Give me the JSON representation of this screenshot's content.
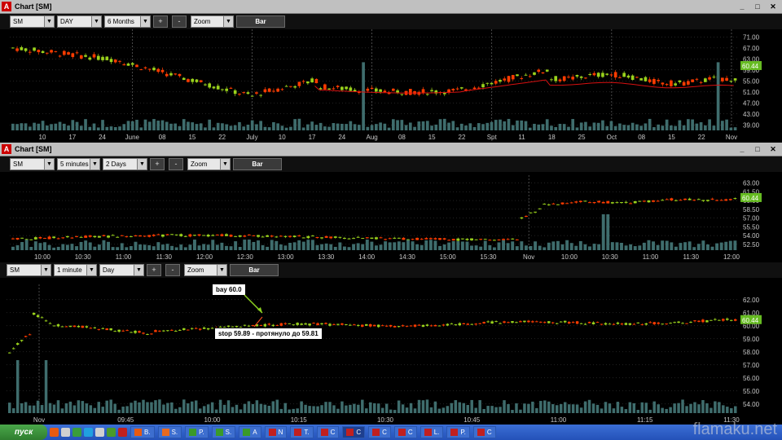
{
  "chart_data": [
    {
      "type": "candlestick",
      "symbol": "SM",
      "interval": "DAY",
      "range": "6 Months",
      "y_ticks": [
        "71.00",
        "67.00",
        "63.00",
        "59.00",
        "55.00",
        "51.00",
        "47.00",
        "43.00",
        "39.00"
      ],
      "x_labels": [
        "10",
        "17",
        "24",
        "June",
        "08",
        "15",
        "22",
        "July",
        "10",
        "17",
        "24",
        "Aug",
        "08",
        "15",
        "22",
        "Spt",
        "11",
        "18",
        "25",
        "Oct",
        "08",
        "15",
        "22",
        "Nov"
      ],
      "last_price": "60.44",
      "ylim": [
        37,
        72
      ],
      "ma": true
    },
    {
      "type": "candlestick",
      "symbol": "SM",
      "interval": "5 minutes",
      "range": "2 Days",
      "y_ticks": [
        "63.00",
        "61.50",
        "60.00",
        "58.50",
        "57.00",
        "55.50",
        "54.00",
        "52.50"
      ],
      "x_labels": [
        "10:00",
        "10:30",
        "11:00",
        "11:30",
        "12:00",
        "12:30",
        "13:00",
        "13:30",
        "14:00",
        "14:30",
        "15:00",
        "15:30",
        "Nov",
        "10:00",
        "10:30",
        "11:00",
        "11:30",
        "12:00"
      ],
      "last_price": "60.44",
      "ylim": [
        51.5,
        63.5
      ]
    },
    {
      "type": "candlestick",
      "symbol": "SM",
      "interval": "1 minute",
      "range": "Day",
      "y_ticks": [
        "62.00",
        "61.00",
        "60.00",
        "59.00",
        "58.00",
        "57.00",
        "56.00",
        "55.00",
        "54.00"
      ],
      "x_labels": [
        "Nov",
        "09:45",
        "10:00",
        "10:15",
        "10:30",
        "10:45",
        "11:00",
        "11:15",
        "11:30"
      ],
      "last_price": "60.44",
      "ylim": [
        53.3,
        62.8
      ],
      "annotations": [
        "bay 60.0",
        "stop 59.89 - протянуло до 59.81"
      ]
    }
  ],
  "windows": [
    {
      "title": "Chart [SM]",
      "symbol": "SM",
      "interval": "DAY",
      "range": "6 Months",
      "zoom": "Zoom",
      "plus": "+",
      "minus": "-",
      "bar": "Bar"
    },
    {
      "title": "Chart [SM]",
      "symbol": "SM",
      "interval": "5 minutes",
      "range": "2 Days",
      "zoom": "Zoom",
      "plus": "+",
      "minus": "-",
      "bar": "Bar"
    },
    {
      "title": "",
      "symbol": "SM",
      "interval": "1 minute",
      "range": "Day",
      "zoom": "Zoom",
      "plus": "+",
      "minus": "-",
      "bar": "Bar"
    }
  ],
  "window_controls": {
    "minimize": "_",
    "maximize": "□",
    "close": "✕",
    "logo": "A"
  },
  "colors": {
    "up": "#9ad21c",
    "down": "#ff3c00",
    "volume": "#3f6d6d",
    "ma": "#d81010",
    "grid": "#444444",
    "price_tag": "#66bb22"
  },
  "taskbar": {
    "start": "пуск",
    "tasks": [
      {
        "label": "B.",
        "icon": "firefox-icon"
      },
      {
        "label": "S.",
        "icon": "skype-icon"
      },
      {
        "label": "P.",
        "icon": "app-icon"
      },
      {
        "label": "S.",
        "icon": "app-icon"
      },
      {
        "label": "A",
        "icon": "app-icon"
      },
      {
        "label": "N",
        "icon": "chart-app-icon"
      },
      {
        "label": "T.",
        "icon": "chart-app-icon"
      },
      {
        "label": "C",
        "icon": "chart-app-icon"
      },
      {
        "label": "C",
        "icon": "chart-app-icon"
      },
      {
        "label": "C",
        "icon": "chart-app-icon"
      },
      {
        "label": "C",
        "icon": "chart-app-icon"
      },
      {
        "label": "L.",
        "icon": "chart-app-icon"
      },
      {
        "label": "P.",
        "icon": "chart-app-icon"
      },
      {
        "label": "C",
        "icon": "chart-app-icon"
      }
    ]
  },
  "watermark": "flamaku.net"
}
